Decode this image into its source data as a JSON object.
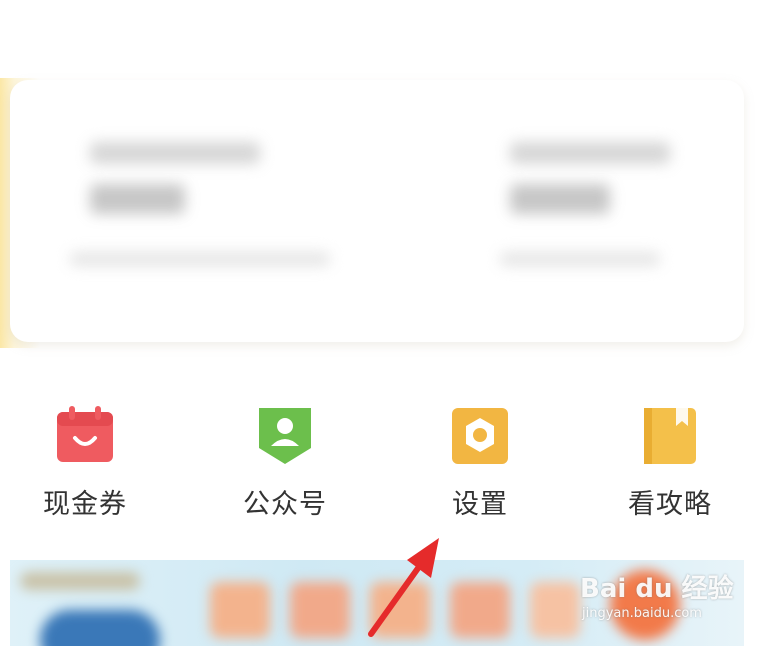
{
  "shortcuts": [
    {
      "label": "现金券",
      "icon": "coupon-calendar-icon",
      "color": "#ef5b60"
    },
    {
      "label": "公众号",
      "icon": "official-account-icon",
      "color": "#6cbf4c"
    },
    {
      "label": "设置",
      "icon": "settings-icon",
      "color": "#f2b642"
    },
    {
      "label": "看攻略",
      "icon": "guide-book-icon",
      "color": "#f4c04a"
    }
  ],
  "annotation": {
    "type": "red-arrow-pointer",
    "target": "设置",
    "color": "#e52b2b"
  },
  "watermark": {
    "brand": "Bai du 经验",
    "url": "jingyan.baidu.com"
  }
}
